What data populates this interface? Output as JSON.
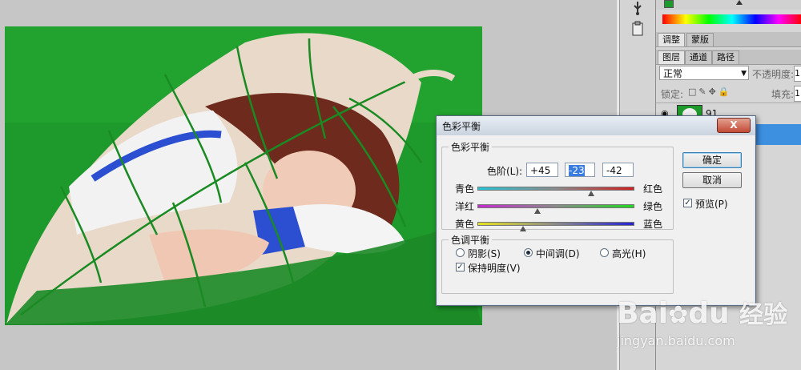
{
  "panels": {
    "tabs_top": [
      "调整",
      "蒙版"
    ],
    "tabs_layers": [
      "图层",
      "通道",
      "路径"
    ],
    "blend_mode": "正常",
    "opacity_label": "不透明度:",
    "opacity_value": "1",
    "lock_label": "锁定:",
    "fill_label": "填充:",
    "fill_value": "1",
    "layer_name": "91"
  },
  "dialog": {
    "title": "色彩平衡",
    "close": "X",
    "color_balance_group": "色彩平衡",
    "levels_label": "色阶(L):",
    "levels": [
      "+45",
      "-23",
      "-42"
    ],
    "sliders": [
      {
        "left": "青色",
        "right": "红色",
        "value": 45,
        "left_color": "#27c4d4",
        "right_color": "#d02020"
      },
      {
        "left": "洋红",
        "right": "绿色",
        "value": -23,
        "left_color": "#c62ad0",
        "right_color": "#1fd81f"
      },
      {
        "left": "黄色",
        "right": "蓝色",
        "value": -42,
        "left_color": "#e6e322",
        "right_color": "#2624d4"
      }
    ],
    "tone_group": "色调平衡",
    "tone_options": [
      "阴影(S)",
      "中间调(D)",
      "高光(H)"
    ],
    "tone_selected": "中间调(D)",
    "preserve_luminosity": "保持明度(V)",
    "ok": "确定",
    "cancel": "取消",
    "preview": "预览(P)"
  },
  "watermark": {
    "brand": "Bai",
    "brand2": "du",
    "cn": "经验",
    "url": "jingyan.baidu.com"
  },
  "colors": {
    "leaf_green": "#1e9a2c",
    "dialog_bg": "#f0f0f0",
    "selection": "#3a7be0"
  }
}
